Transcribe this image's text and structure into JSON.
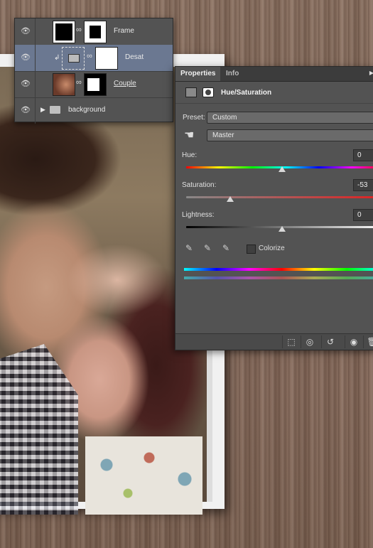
{
  "layers": [
    {
      "name": "Frame",
      "selected": false,
      "thumb_icon": "frame-thumb"
    },
    {
      "name": "Desat",
      "selected": true,
      "thumb_icon": "adjustment-thumb"
    },
    {
      "name": "Couple",
      "selected": false,
      "thumb_icon": "photo-thumb"
    },
    {
      "name": "background",
      "selected": false,
      "thumb_icon": "folder-icon"
    }
  ],
  "properties": {
    "tabs": [
      "Properties",
      "Info"
    ],
    "title": "Hue/Saturation",
    "preset_label": "Preset:",
    "preset_value": "Custom",
    "channel_value": "Master",
    "hue_label": "Hue:",
    "hue_value": "0",
    "saturation_label": "Saturation:",
    "saturation_value": "-53",
    "lightness_label": "Lightness:",
    "lightness_value": "0",
    "colorize_label": "Colorize",
    "colorize_checked": false
  },
  "colors": {
    "selected_layer": "#6b7891",
    "panel_bg": "#535353"
  }
}
